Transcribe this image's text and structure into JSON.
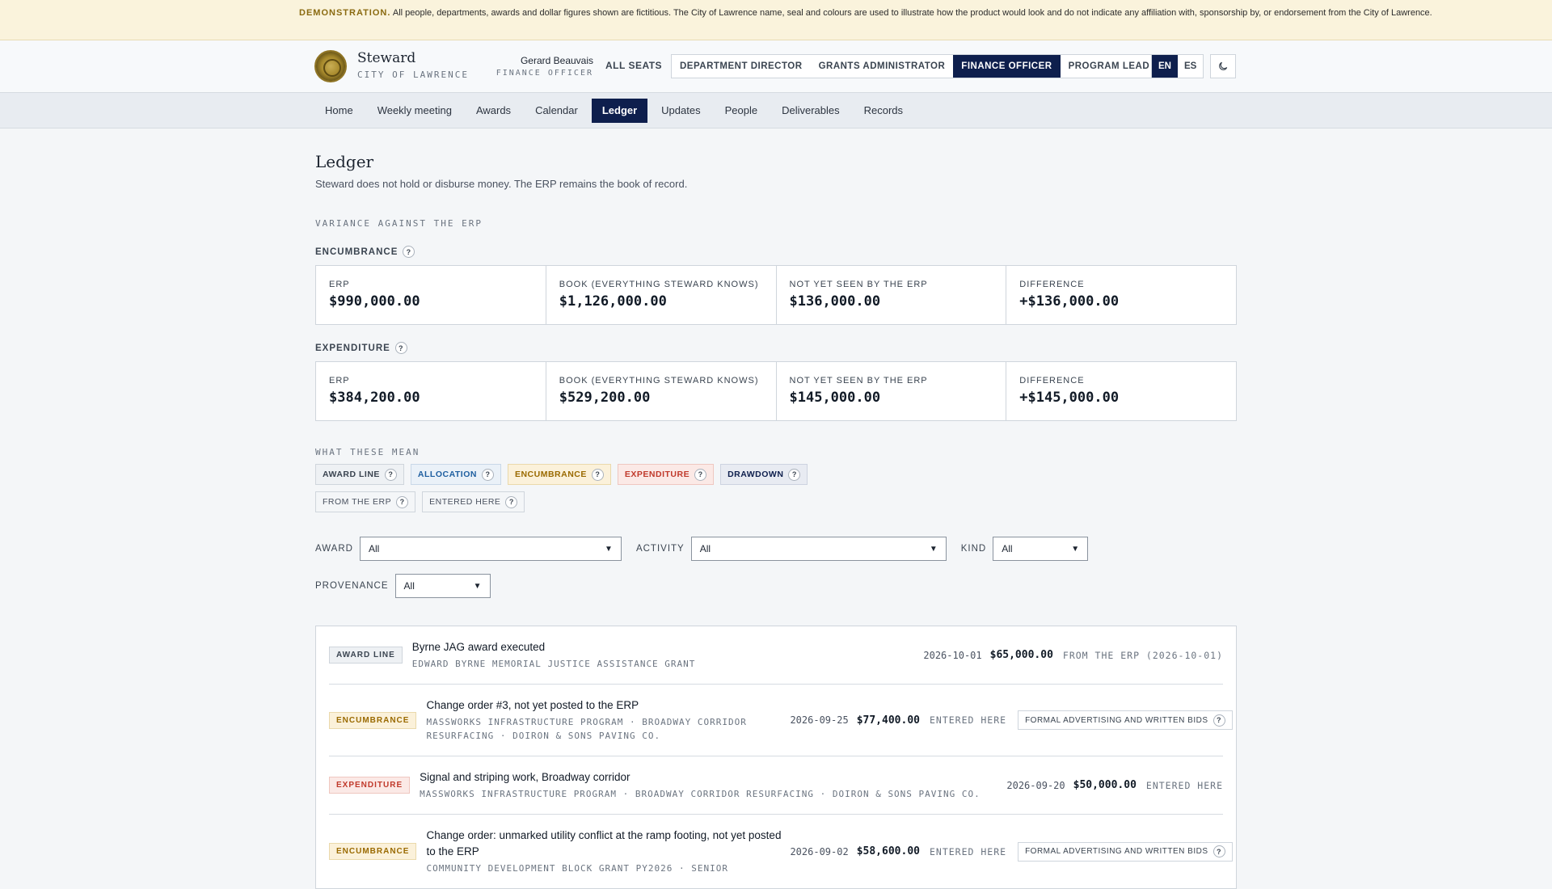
{
  "banner": {
    "label": "DEMONSTRATION.",
    "text": "All people, departments, awards and dollar figures shown are fictitious. The City of Lawrence name, seal and colours are used to illustrate how the product would look and do not indicate any affiliation with, sponsorship by, or endorsement from the City of Lawrence."
  },
  "header": {
    "app_name": "Steward",
    "city": "CITY OF LAWRENCE",
    "user_name": "Gerard Beauvais",
    "user_role": "FINANCE OFFICER",
    "all_seats": "ALL SEATS",
    "seats": [
      {
        "label": "DEPARTMENT DIRECTOR",
        "active": false
      },
      {
        "label": "GRANTS ADMINISTRATOR",
        "active": false
      },
      {
        "label": "FINANCE OFFICER",
        "active": true
      },
      {
        "label": "PROGRAM LEAD",
        "active": false
      }
    ],
    "languages": [
      {
        "label": "EN",
        "active": true
      },
      {
        "label": "ES",
        "active": false
      }
    ],
    "theme_icon": "moon-icon"
  },
  "nav": {
    "items": [
      "Home",
      "Weekly meeting",
      "Awards",
      "Calendar",
      "Ledger",
      "Updates",
      "People",
      "Deliverables",
      "Records"
    ],
    "active": "Ledger"
  },
  "page": {
    "title": "Ledger",
    "subtitle": "Steward does not hold or disburse money. The ERP remains the book of record.",
    "variance_label": "VARIANCE AGAINST THE ERP"
  },
  "variance": {
    "encumbrance": {
      "label": "ENCUMBRANCE",
      "help": "?",
      "cards": [
        {
          "label": "ERP",
          "value": "$990,000.00"
        },
        {
          "label": "BOOK (EVERYTHING STEWARD KNOWS)",
          "value": "$1,126,000.00"
        },
        {
          "label": "NOT YET SEEN BY THE ERP",
          "value": "$136,000.00"
        },
        {
          "label": "DIFFERENCE",
          "value": "+$136,000.00"
        }
      ]
    },
    "expenditure": {
      "label": "EXPENDITURE",
      "help": "?",
      "cards": [
        {
          "label": "ERP",
          "value": "$384,200.00"
        },
        {
          "label": "BOOK (EVERYTHING STEWARD KNOWS)",
          "value": "$529,200.00"
        },
        {
          "label": "NOT YET SEEN BY THE ERP",
          "value": "$145,000.00"
        },
        {
          "label": "DIFFERENCE",
          "value": "+$145,000.00"
        }
      ]
    }
  },
  "legend": {
    "label": "WHAT THESE MEAN",
    "tags": [
      "AWARD LINE",
      "ALLOCATION",
      "ENCUMBRANCE",
      "EXPENDITURE",
      "DRAWDOWN",
      "FROM THE ERP",
      "ENTERED HERE"
    ],
    "help": "?"
  },
  "filters": {
    "award_label": "AWARD",
    "award_value": "All",
    "activity_label": "ACTIVITY",
    "activity_value": "All",
    "kind_label": "KIND",
    "kind_value": "All",
    "provenance_label": "PROVENANCE",
    "provenance_value": "All"
  },
  "ledger": {
    "rows": [
      {
        "kind": "AWARD LINE",
        "title": "Byrne JAG award executed",
        "meta": "EDWARD BYRNE MEMORIAL JUSTICE ASSISTANCE GRANT",
        "date": "2026-10-01",
        "amount": "$65,000.00",
        "provenance": "FROM THE ERP (2026-10-01)",
        "method": ""
      },
      {
        "kind": "ENCUMBRANCE",
        "title": "Change order #3, not yet posted to the ERP",
        "meta": "MASSWORKS INFRASTRUCTURE PROGRAM · BROADWAY CORRIDOR RESURFACING · DOIRON & SONS PAVING CO.",
        "date": "2026-09-25",
        "amount": "$77,400.00",
        "provenance": "ENTERED HERE",
        "method": "FORMAL ADVERTISING AND WRITTEN BIDS"
      },
      {
        "kind": "EXPENDITURE",
        "title": "Signal and striping work, Broadway corridor",
        "meta": "MASSWORKS INFRASTRUCTURE PROGRAM · BROADWAY CORRIDOR RESURFACING · DOIRON & SONS PAVING CO.",
        "date": "2026-09-20",
        "amount": "$50,000.00",
        "provenance": "ENTERED HERE",
        "method": ""
      },
      {
        "kind": "ENCUMBRANCE",
        "title": "Change order: unmarked utility conflict at the ramp footing, not yet posted to the ERP",
        "meta": "COMMUNITY DEVELOPMENT BLOCK GRANT PY2026 · SENIOR",
        "date": "2026-09-02",
        "amount": "$58,600.00",
        "provenance": "ENTERED HERE",
        "method": "FORMAL ADVERTISING AND WRITTEN BIDS"
      }
    ]
  }
}
